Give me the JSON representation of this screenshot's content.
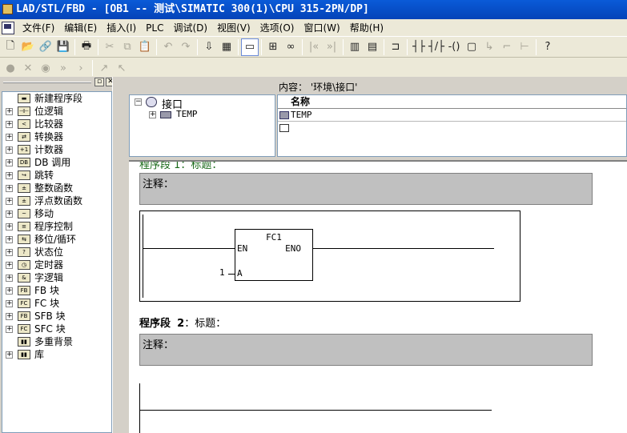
{
  "title": "LAD/STL/FBD  - [OB1 -- 测试\\SIMATIC 300(1)\\CPU 315-2PN/DP]",
  "menu": [
    "文件(F)",
    "编辑(E)",
    "插入(I)",
    "PLC",
    "调试(D)",
    "视图(V)",
    "选项(O)",
    "窗口(W)",
    "帮助(H)"
  ],
  "toolbar1": [
    {
      "name": "new-icon",
      "glyph": "🗋"
    },
    {
      "name": "open-icon",
      "glyph": "📂"
    },
    {
      "name": "access-icon",
      "glyph": "🔗"
    },
    {
      "name": "save-icon",
      "glyph": "💾"
    },
    {
      "name": "print-icon",
      "glyph": "🖶"
    },
    {
      "name": "cut-icon",
      "glyph": "✂"
    },
    {
      "name": "copy-icon",
      "glyph": "⧉"
    },
    {
      "name": "paste-icon",
      "glyph": "📋"
    },
    {
      "name": "undo-icon",
      "glyph": "↶"
    },
    {
      "name": "redo-icon",
      "glyph": "↷"
    },
    {
      "name": "download-icon",
      "glyph": "⇩"
    },
    {
      "name": "monitor-icon",
      "glyph": "▦"
    },
    {
      "name": "network-icon",
      "glyph": "▭"
    },
    {
      "name": "overview-icon",
      "glyph": "⊞"
    },
    {
      "name": "glasses-icon",
      "glyph": "∞"
    },
    {
      "name": "prev-icon",
      "glyph": "|«"
    },
    {
      "name": "next-icon",
      "glyph": "»|"
    },
    {
      "name": "overview-toggle-icon",
      "glyph": "▥"
    },
    {
      "name": "details-icon",
      "glyph": "▤"
    },
    {
      "name": "branch-new-icon",
      "glyph": "⊐"
    },
    {
      "name": "contact-no-icon",
      "glyph": "┤├"
    },
    {
      "name": "contact-nc-icon",
      "glyph": "┤/├"
    },
    {
      "name": "coil-icon",
      "glyph": "-()"
    },
    {
      "name": "box-icon",
      "glyph": "▢"
    },
    {
      "name": "branch-open-icon",
      "glyph": "↳"
    },
    {
      "name": "branch-close-icon",
      "glyph": "⌐"
    },
    {
      "name": "connect-icon",
      "glyph": "⊢"
    },
    {
      "name": "help-icon",
      "glyph": "?"
    }
  ],
  "toolbar2": [
    {
      "name": "breakpoint-icon",
      "glyph": "●"
    },
    {
      "name": "delete-breakpoint-icon",
      "glyph": "✕"
    },
    {
      "name": "activate-icon",
      "glyph": "◉"
    },
    {
      "name": "resume-icon",
      "glyph": "»"
    },
    {
      "name": "step-icon",
      "glyph": "›"
    },
    {
      "name": "step-into-icon",
      "glyph": "↗"
    },
    {
      "name": "step-out-icon",
      "glyph": "↖"
    }
  ],
  "left_tree": [
    {
      "label": "新建程序段",
      "icon": "new-segment-icon",
      "iconText": "▬",
      "expander": false
    },
    {
      "label": "位逻辑",
      "icon": "bit-logic-icon",
      "iconText": "⊣⊢",
      "expander": true
    },
    {
      "label": "比较器",
      "icon": "comparator-icon",
      "iconText": "<",
      "expander": true
    },
    {
      "label": "转换器",
      "icon": "converter-icon",
      "iconText": "⇄",
      "expander": true
    },
    {
      "label": "计数器",
      "icon": "counter-icon",
      "iconText": "+1",
      "expander": true
    },
    {
      "label": "DB 调用",
      "icon": "db-call-icon",
      "iconText": "DB",
      "expander": true
    },
    {
      "label": "跳转",
      "icon": "jump-icon",
      "iconText": "↪",
      "expander": true
    },
    {
      "label": "整数函数",
      "icon": "integer-icon",
      "iconText": "±",
      "expander": true
    },
    {
      "label": "浮点数函数",
      "icon": "float-icon",
      "iconText": "±",
      "expander": true
    },
    {
      "label": "移动",
      "icon": "move-icon",
      "iconText": "~",
      "expander": true
    },
    {
      "label": "程序控制",
      "icon": "program-control-icon",
      "iconText": "≡",
      "expander": true
    },
    {
      "label": "移位/循环",
      "icon": "shift-icon",
      "iconText": "⇆",
      "expander": true
    },
    {
      "label": "状态位",
      "icon": "status-bit-icon",
      "iconText": "?",
      "expander": true
    },
    {
      "label": "定时器",
      "icon": "timer-icon",
      "iconText": "◷",
      "expander": true
    },
    {
      "label": "字逻辑",
      "icon": "word-logic-icon",
      "iconText": "&",
      "expander": true
    },
    {
      "label": "FB 块",
      "icon": "fb-block-icon",
      "iconText": "FB",
      "expander": true
    },
    {
      "label": "FC 块",
      "icon": "fc-block-icon",
      "iconText": "FC",
      "expander": true
    },
    {
      "label": "SFB 块",
      "icon": "sfb-block-icon",
      "iconText": "FB",
      "expander": true
    },
    {
      "label": "SFC 块",
      "icon": "sfc-block-icon",
      "iconText": "FC",
      "expander": true
    },
    {
      "label": "多重背景",
      "icon": "multi-instance-icon",
      "iconText": "▮▮",
      "expander": false
    },
    {
      "label": "库",
      "icon": "library-icon",
      "iconText": "▮▮",
      "expander": true
    }
  ],
  "interface": {
    "content_label": "内容：  '环境\\接口'",
    "root": "接口",
    "child": "TEMP",
    "column_name": "名称",
    "row1": "TEMP"
  },
  "segment1": {
    "partial_title": "程序段 1：标题：",
    "comment": "注释：",
    "block": "FC1",
    "en": "EN",
    "eno": "ENO",
    "pin_a": "A",
    "value_a": "1"
  },
  "segment2": {
    "label": "程序段",
    "number": "2",
    "title": "：标题：",
    "comment": "注释："
  }
}
